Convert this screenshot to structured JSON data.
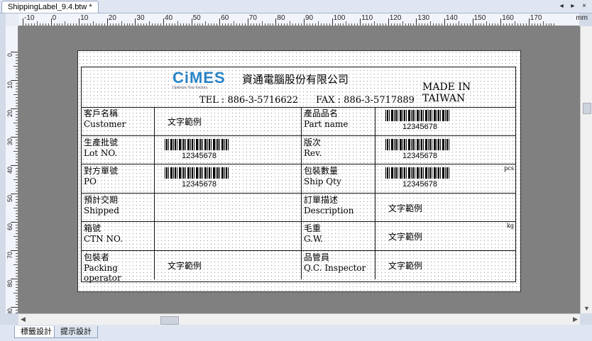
{
  "tabs": {
    "document": "ShippingLabel_9.4.btw *",
    "nav": "◂ ▸ ×"
  },
  "ruler": {
    "unit": "mm",
    "h_ticks": [
      "-10",
      "0",
      "10",
      "20",
      "30",
      "40",
      "50",
      "60",
      "70",
      "80",
      "90",
      "100",
      "110",
      "120",
      "130",
      "140",
      "150",
      "160",
      "170"
    ],
    "v_ticks": [
      "0",
      "10",
      "20",
      "30",
      "40",
      "50",
      "60",
      "70",
      "80",
      "90"
    ]
  },
  "label": {
    "logo": "CiMES",
    "logo_sub": "Optimize Your Factory",
    "company": "資通電腦股份有限公司",
    "made_in": "MADE IN TAIWAN",
    "contact": "TEL : 886-3-5716622      FAX : 886-3-5717889",
    "rows": [
      {
        "l1": "客戶名稱",
        "l1e": "Customer",
        "v1": "文字範例",
        "l2": "產品品名",
        "l2e": "Part name",
        "v2": "12345678"
      },
      {
        "l1": "生產批號",
        "l1e": "Lot NO.",
        "v1": "12345678",
        "l2": "版次",
        "l2e": "Rev.",
        "v2": "12345678"
      },
      {
        "l1": "對方單號",
        "l1e": "PO",
        "v1": "12345678",
        "l2": "包裝數量",
        "l2e": "Ship Qty",
        "v2": "12345678"
      },
      {
        "l1": "預計交期",
        "l1e": "Shipped",
        "v1": "",
        "l2": "訂單描述",
        "l2e": "Description",
        "v2": "文字範例"
      },
      {
        "l1": "箱號",
        "l1e": "CTN NO.",
        "v1": "",
        "l2": "毛重",
        "l2e": "G.W.",
        "v2": "文字範例"
      },
      {
        "l1": "包裝者",
        "l1e": "Packing operator",
        "v1": "文字範例",
        "l2": "品管員",
        "l2e": "Q.C. Inspector",
        "v2": "文字範例"
      }
    ],
    "unit_pcs": "pcs",
    "unit_kg": "kg"
  },
  "bottom_tabs": [
    "標籤設計",
    "提示設計"
  ]
}
